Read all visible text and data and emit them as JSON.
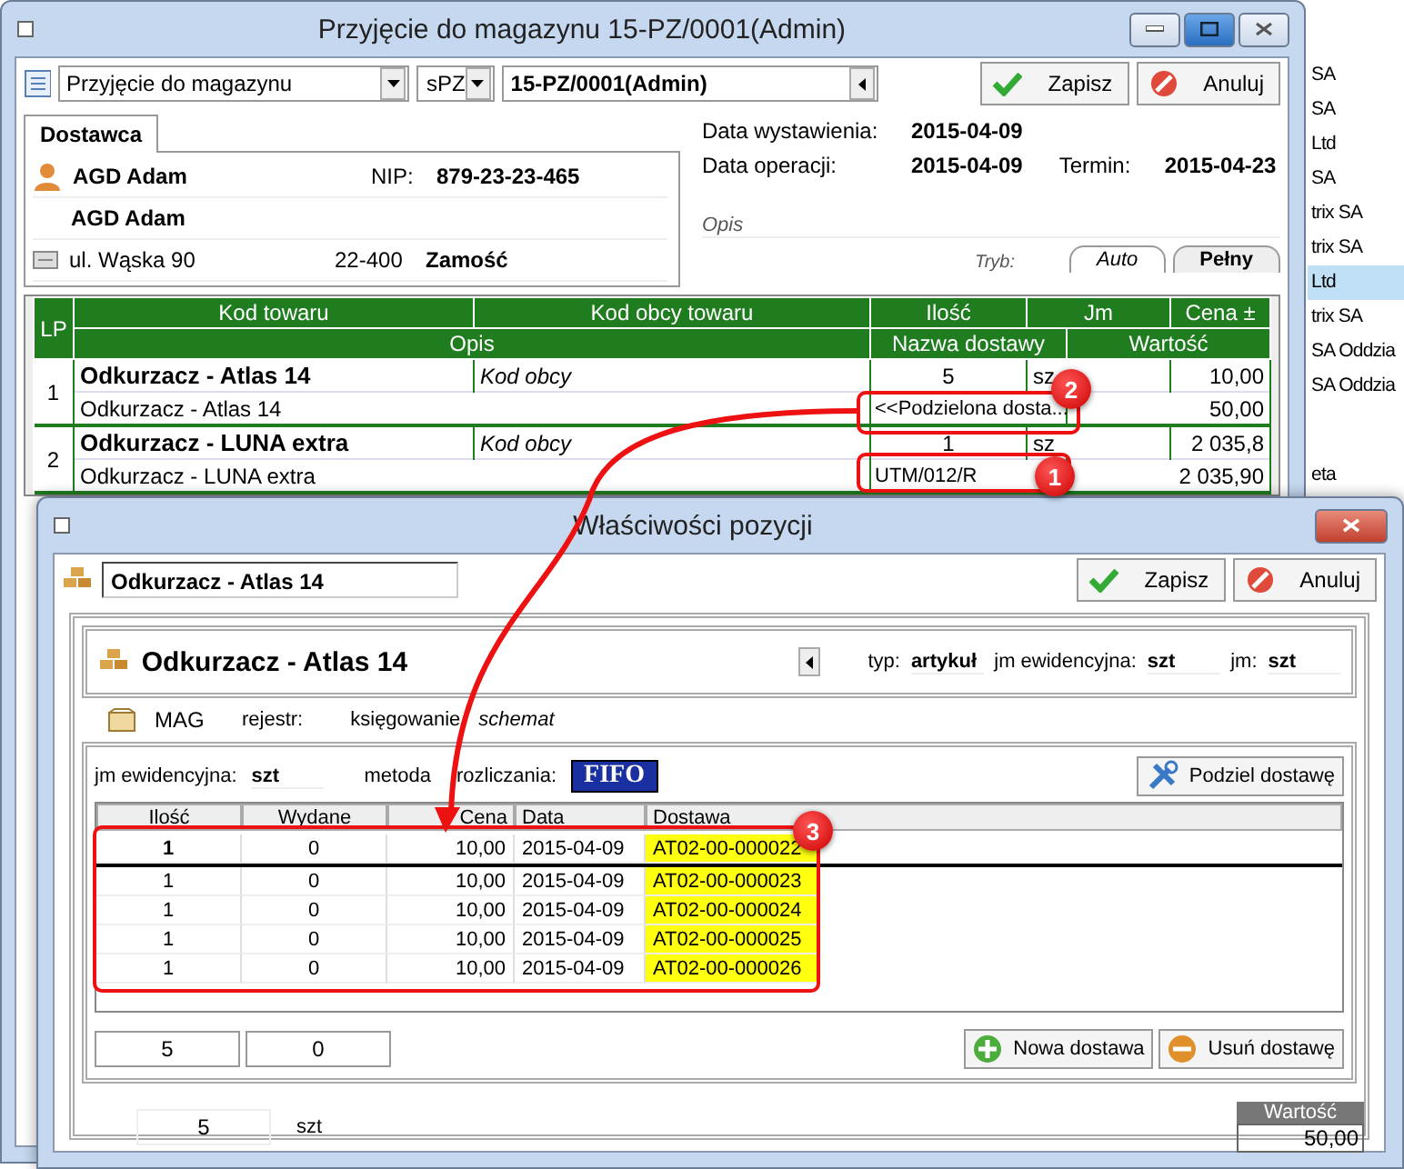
{
  "background_list": {
    "items": [
      {
        "label": "SA",
        "selected": false
      },
      {
        "label": "SA",
        "selected": false
      },
      {
        "label": "Ltd",
        "selected": false
      },
      {
        "label": "SA",
        "selected": false
      },
      {
        "label": "trix SA",
        "selected": false
      },
      {
        "label": "trix SA",
        "selected": false
      },
      {
        "label": "Ltd",
        "selected": true
      },
      {
        "label": "trix SA",
        "selected": false
      },
      {
        "label": "SA Oddzia",
        "selected": false
      },
      {
        "label": "SA Oddzia",
        "selected": false
      },
      {
        "label": "eta",
        "selected": false
      }
    ]
  },
  "main_window": {
    "title": "Przyjęcie do magazynu 15-PZ/0001(Admin)",
    "toolbar": {
      "document_type": "Przyjęcie do magazynu",
      "series": "sPZ",
      "number": "15-PZ/0001(Admin)",
      "buttons": [
        "Zapisz",
        "Anuluj"
      ]
    },
    "supplier_tab": "Dostawca",
    "supplier": {
      "name": "AGD Adam",
      "nip_label": "NIP:",
      "nip": "879-23-23-465",
      "name2": "AGD Adam",
      "street": "ul. Wąska 90",
      "postcode": "22-400",
      "city": "Zamość"
    },
    "dates": {
      "issue_label": "Data wystawienia:",
      "issue": "2015-04-09",
      "operation_label": "Data operacji:",
      "operation": "2015-04-09",
      "due_label": "Termin:",
      "due": "2015-04-23"
    },
    "description_label": "Opis",
    "mode_label": "Tryb:",
    "mode_tabs": [
      {
        "label": "Auto",
        "selected": false
      },
      {
        "label": "Pełny",
        "selected": true
      }
    ],
    "grid": {
      "header1": [
        "LP",
        "Kod towaru",
        "Kod obcy towaru",
        "Ilość",
        "Jm",
        "Cena ±"
      ],
      "header2": [
        "Opis",
        "Nazwa dostawy",
        "Wartość"
      ],
      "rows": [
        {
          "lp": "1",
          "code": "Odkurzacz - Atlas 14",
          "foreign_code": "Kod obcy",
          "qty": "5",
          "unit": "sz",
          "price": "10,00",
          "description": "Odkurzacz - Atlas 14",
          "delivery": "<<Podzielona dosta...",
          "value": "50,00"
        },
        {
          "lp": "2",
          "code": "Odkurzacz - LUNA extra",
          "foreign_code": "Kod obcy",
          "qty": "1",
          "unit": "sz",
          "price": "2 035,8",
          "description": "Odkurzacz - LUNA extra",
          "delivery": "UTM/012/R",
          "value": "2 035,90"
        }
      ]
    }
  },
  "dialog": {
    "title": "Właściwości pozycji",
    "item_field": "Odkurzacz - Atlas 14",
    "buttons": [
      "Zapisz",
      "Anuluj"
    ],
    "product": {
      "name": "Odkurzacz - Atlas 14",
      "type_label": "typ:",
      "type": "artykuł",
      "unit_label": "jm ewidencyjna:",
      "unit": "szt",
      "jm_label": "jm:",
      "jm": "szt"
    },
    "warehouse": "MAG",
    "register_label": "rejestr:",
    "posting_label": "księgowanie",
    "posting": "schemat",
    "method": {
      "unit_label": "jm ewidencyjna:",
      "unit": "szt",
      "method_label": "metoda rozliczania:",
      "method": "FIFO",
      "split_button": "Podziel dostawę"
    },
    "table": {
      "columns": [
        "Ilość",
        "Wydane",
        "Cena",
        "Data",
        "Dostawa"
      ],
      "rows": [
        {
          "cells": [
            "1",
            "0",
            "10,00",
            "2015-04-09",
            "AT02-00-000022"
          ],
          "selected": true
        },
        {
          "cells": [
            "1",
            "0",
            "10,00",
            "2015-04-09",
            "AT02-00-000023"
          ],
          "selected": false
        },
        {
          "cells": [
            "1",
            "0",
            "10,00",
            "2015-04-09",
            "AT02-00-000024"
          ],
          "selected": false
        },
        {
          "cells": [
            "1",
            "0",
            "10,00",
            "2015-04-09",
            "AT02-00-000025"
          ],
          "selected": false
        },
        {
          "cells": [
            "1",
            "0",
            "10,00",
            "2015-04-09",
            "AT02-00-000026"
          ],
          "selected": false
        }
      ]
    },
    "totals": [
      "5",
      "0"
    ],
    "action_buttons": [
      {
        "kind": "add",
        "label": "Nowa dostawa"
      },
      {
        "kind": "remove",
        "label": "Usuń dostawę"
      }
    ],
    "quantity": "5",
    "quantity_unit": "szt",
    "value_label": "Wartość",
    "value": "50,00"
  },
  "annotations": [
    {
      "label": "1"
    },
    {
      "label": "2"
    },
    {
      "label": "3"
    }
  ]
}
